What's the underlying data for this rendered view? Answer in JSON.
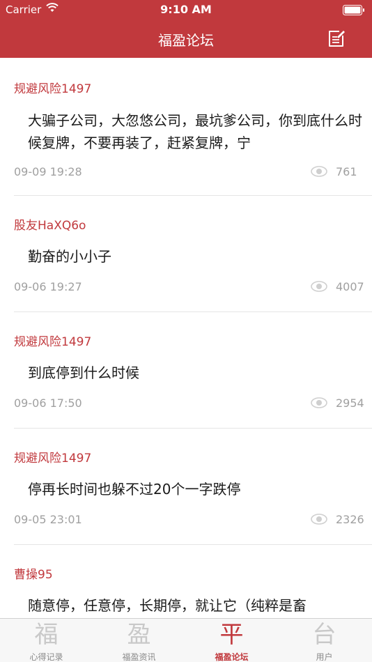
{
  "status_bar": {
    "carrier": "Carrier",
    "time": "9:10 AM"
  },
  "nav": {
    "title": "福盈论坛"
  },
  "posts": [
    {
      "author": "规避风险1497",
      "content": "大骗子公司，大忽悠公司，最坑爹公司，你到底什么时候复牌，不要再装了，赶紧复牌，宁",
      "time": "09-09 19:28",
      "views": "761"
    },
    {
      "author": "股友HaXQ6o",
      "content": "勤奋的小小子",
      "time": "09-06 19:27",
      "views": "4007"
    },
    {
      "author": "规避风险1497",
      "content": "到底停到什么时候",
      "time": "09-06 17:50",
      "views": "2954"
    },
    {
      "author": "规避风险1497",
      "content": "停再长时间也躲不过20个一字跌停",
      "time": "09-05 23:01",
      "views": "2326"
    },
    {
      "author": "曹操95",
      "content": "随意停，任意停，长期停，就让它（纯粹是畜"
    }
  ],
  "tabs": [
    {
      "glyph": "福",
      "label": "心得记录",
      "active": false
    },
    {
      "glyph": "盈",
      "label": "福盈资讯",
      "active": false
    },
    {
      "glyph": "平",
      "label": "福盈论坛",
      "active": true
    },
    {
      "glyph": "台",
      "label": "用户",
      "active": false
    }
  ],
  "colors": {
    "brand": "#c1393d",
    "author": "#c1393d",
    "muted": "#a0a0a0"
  },
  "icons": {
    "compose": "compose-icon",
    "views": "eye-icon",
    "wifi": "wifi-icon",
    "battery": "battery-icon"
  }
}
